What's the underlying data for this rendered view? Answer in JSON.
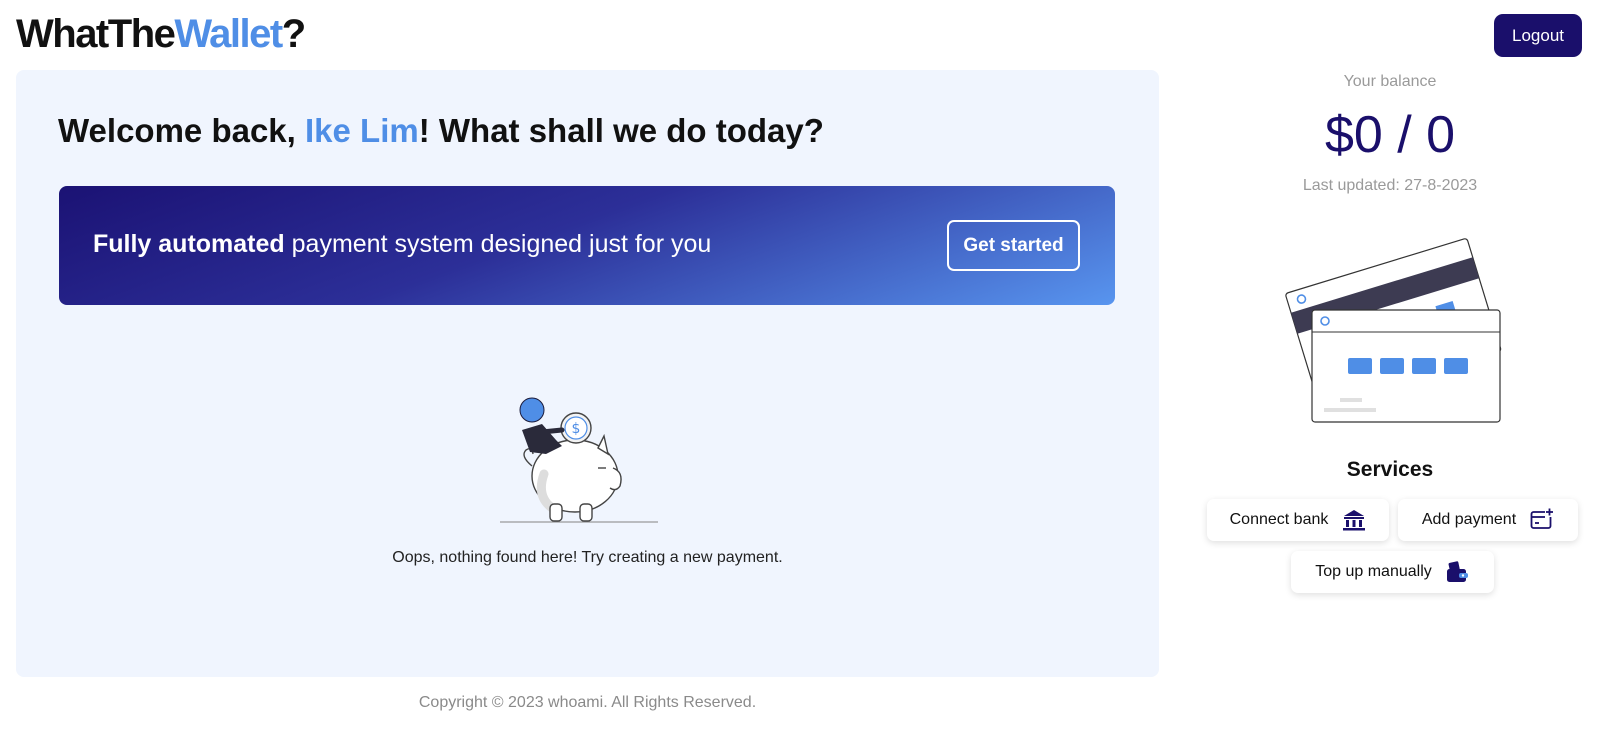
{
  "header": {
    "logo_part1": "WhatThe",
    "logo_part2": "Wallet",
    "logo_part3": "?",
    "logout_label": "Logout"
  },
  "main": {
    "welcome_prefix": "Welcome back, ",
    "user_name": "Ike Lim",
    "welcome_suffix": "! What shall we do today?",
    "banner": {
      "bold_text": "Fully automated",
      "text": " payment system designed just for you",
      "button_label": "Get started"
    },
    "empty_state": {
      "illustration_icon": "piggy-bank-icon",
      "message": "Oops, nothing found here! Try creating a new payment."
    }
  },
  "sidebar": {
    "balance_label": "Your balance",
    "balance_value": "$0 / 0",
    "last_updated": "Last updated: 27-8-2023",
    "illustration_icon": "credit-cards-icon",
    "services_title": "Services",
    "services": [
      {
        "label": "Connect bank",
        "icon": "bank-icon"
      },
      {
        "label": "Add payment",
        "icon": "add-card-icon"
      },
      {
        "label": "Top up manually",
        "icon": "wallet-icon"
      }
    ]
  },
  "footer": {
    "copyright": "Copyright © 2023 whoami. All Rights Reserved."
  },
  "colors": {
    "brand_dark": "#1a0f6b",
    "accent_blue": "#4f8ee6",
    "panel_bg": "#f0f5fe",
    "muted_text": "#9a9a9a"
  }
}
